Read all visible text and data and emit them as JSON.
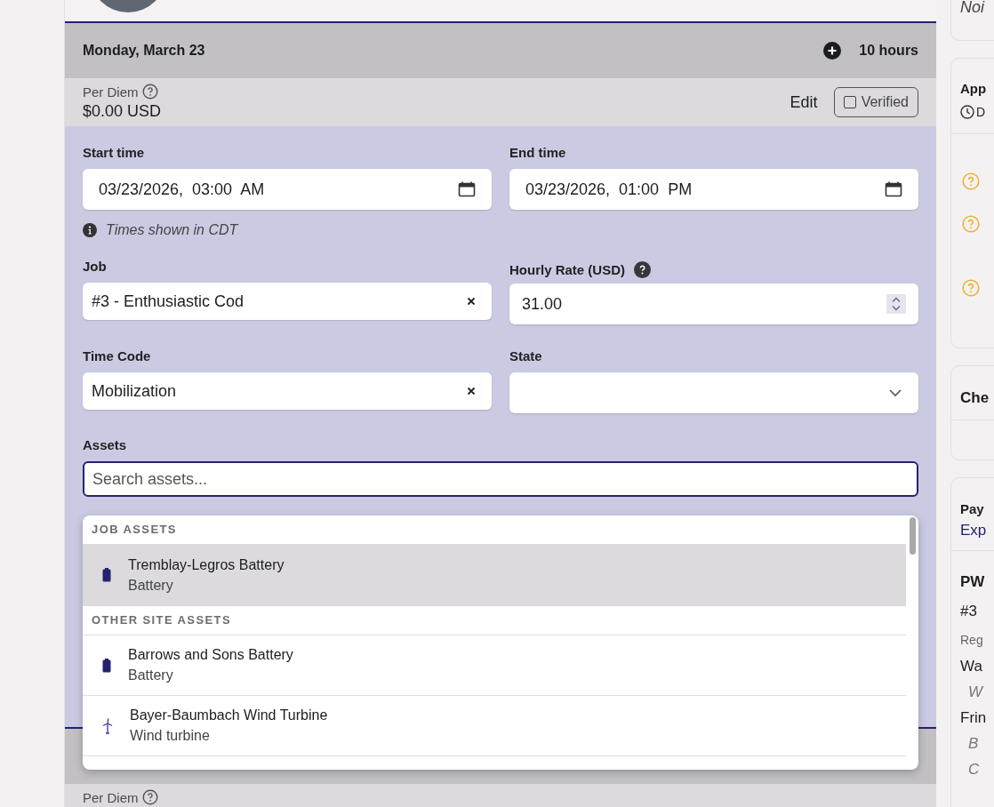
{
  "day": {
    "date": "Monday, March 23",
    "hours": "10 hours",
    "per_diem": {
      "label": "Per Diem",
      "amount": "$0.00 USD"
    },
    "edit": "Edit",
    "verified": {
      "label": "Verified",
      "checked": false
    }
  },
  "form": {
    "start_time": {
      "label": "Start time",
      "value": "03/23/2026,  03:00  AM"
    },
    "end_time": {
      "label": "End time",
      "value": "03/23/2026,  01:00  PM"
    },
    "timezone_note": "Times shown in CDT",
    "job": {
      "label": "Job",
      "value": "#3 - Enthusiastic Cod"
    },
    "hourly_rate": {
      "label": "Hourly Rate (USD)",
      "value": "31.00"
    },
    "time_code": {
      "label": "Time Code",
      "value": "Mobilization"
    },
    "state": {
      "label": "State"
    },
    "assets": {
      "label": "Assets",
      "placeholder": "Search assets...",
      "focused": true
    }
  },
  "asset_dropdown": {
    "sections": [
      {
        "title": "JOB ASSETS",
        "items": [
          {
            "name": "Tremblay-Legros Battery",
            "type": "Battery",
            "kind": "battery",
            "selected": true
          }
        ]
      },
      {
        "title": "OTHER SITE ASSETS",
        "items": [
          {
            "name": "Barrows and Sons Battery",
            "type": "Battery",
            "kind": "battery",
            "selected": false
          },
          {
            "name": "Bayer-Baumbach Wind Turbine",
            "type": "Wind turbine",
            "kind": "wind_turbine",
            "selected": false
          }
        ]
      }
    ]
  },
  "next_day": {
    "per_diem_label": "Per Diem"
  },
  "sidebar": {
    "cards": [
      {
        "kind": "note",
        "text": "Noi"
      },
      {
        "kind": "approval",
        "title": "App",
        "detail": "D"
      },
      {
        "kind": "plain",
        "title": "Che"
      },
      {
        "kind": "pay",
        "title": "Pay",
        "link": "Exp",
        "rows": [
          {
            "kind": "heading",
            "text": "PW"
          },
          {
            "kind": "value",
            "text": "#3"
          },
          {
            "kind": "label",
            "text": "Reg"
          },
          {
            "kind": "value",
            "text": "Wa"
          },
          {
            "kind": "sub",
            "text": "W"
          },
          {
            "kind": "value",
            "text": "Frin"
          },
          {
            "kind": "sub",
            "text": "B"
          },
          {
            "kind": "sub",
            "text": "C"
          }
        ]
      }
    ]
  }
}
